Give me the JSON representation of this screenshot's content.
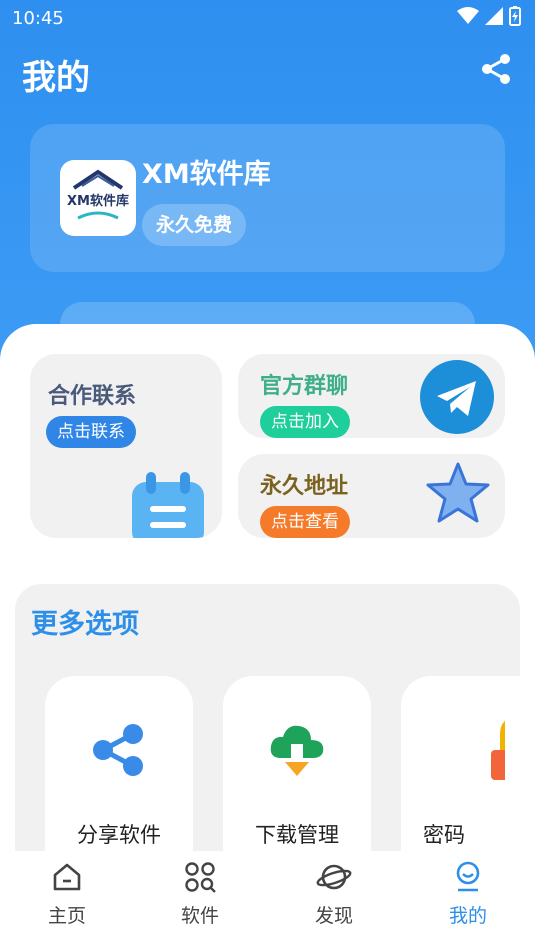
{
  "status": {
    "time": "10:45"
  },
  "header": {
    "title": "我的"
  },
  "profile": {
    "app_name": "XM软件库",
    "badge": "永久免费",
    "logo_text": "XM软件库"
  },
  "tiles": {
    "contact": {
      "title": "合作联系",
      "button": "点击联系"
    },
    "group": {
      "title": "官方群聊",
      "button": "点击加入"
    },
    "address": {
      "title": "永久地址",
      "button": "点击查看"
    }
  },
  "more": {
    "title": "更多选项",
    "options": [
      {
        "label": "分享软件",
        "icon": "share-icon"
      },
      {
        "label": "下载管理",
        "icon": "cloud-download-icon"
      },
      {
        "label": "密码",
        "icon": "lock-icon"
      }
    ]
  },
  "tabbar": {
    "tabs": [
      {
        "label": "主页",
        "icon": "home-icon"
      },
      {
        "label": "软件",
        "icon": "apps-search-icon"
      },
      {
        "label": "发现",
        "icon": "planet-icon"
      },
      {
        "label": "我的",
        "icon": "profile-icon",
        "active": true
      }
    ]
  },
  "colors": {
    "primary": "#2e8fe8",
    "contact_pill": "#2f86e6",
    "group_pill": "#1ecf9c",
    "address_pill": "#f57b2a",
    "group_title": "#3fae8a",
    "address_title": "#7a6220",
    "contact_title": "#4a5a7a"
  }
}
